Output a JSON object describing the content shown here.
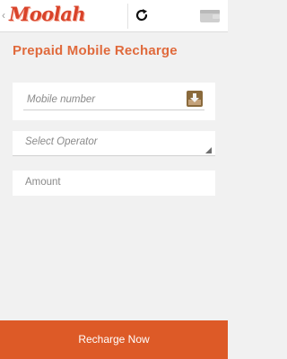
{
  "header": {
    "back_glyph": "‹",
    "logo_text": "Moolah",
    "refresh_icon": "refresh-icon",
    "wallet_icon": "wallet-icon"
  },
  "page": {
    "title": "Prepaid Mobile Recharge"
  },
  "form": {
    "mobile_placeholder": "Mobile number",
    "operator_placeholder": "Select Operator",
    "amount_placeholder": "Amount"
  },
  "footer": {
    "recharge_label": "Recharge Now"
  },
  "colors": {
    "brand": "#d9432a",
    "accent": "#e06a3c",
    "button": "#dd5a27"
  }
}
